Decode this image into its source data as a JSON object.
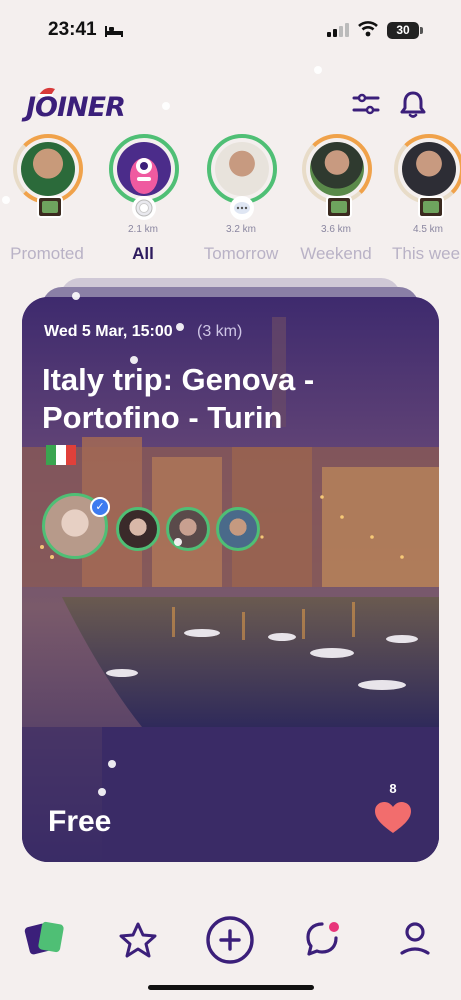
{
  "status": {
    "time": "23:41",
    "battery": "30"
  },
  "header": {
    "logo": "JOINER"
  },
  "stories": [
    {
      "label": "Promoted",
      "distance": ""
    },
    {
      "label": "All",
      "distance": "2.1 km"
    },
    {
      "label": "Tomorrow",
      "distance": "3.2 km"
    },
    {
      "label": "Weekend",
      "distance": "3.6 km"
    },
    {
      "label": "This wee",
      "distance": "4.5 km"
    }
  ],
  "card": {
    "date": "Wed 5 Mar, 15:00",
    "distance": "(3 km)",
    "title": "Italy trip: Genova - Portofino - Turin",
    "price": "Free",
    "likes": "8"
  },
  "colors": {
    "brand": "#3b1f7a",
    "card_bg": "#4a3276",
    "green_ring": "#4fbf75",
    "orange_ring": "#f0a24a",
    "heart": "#f26d6d"
  },
  "nav": [
    "cards-icon",
    "star-icon",
    "plus-icon",
    "chat-icon",
    "profile-icon"
  ]
}
